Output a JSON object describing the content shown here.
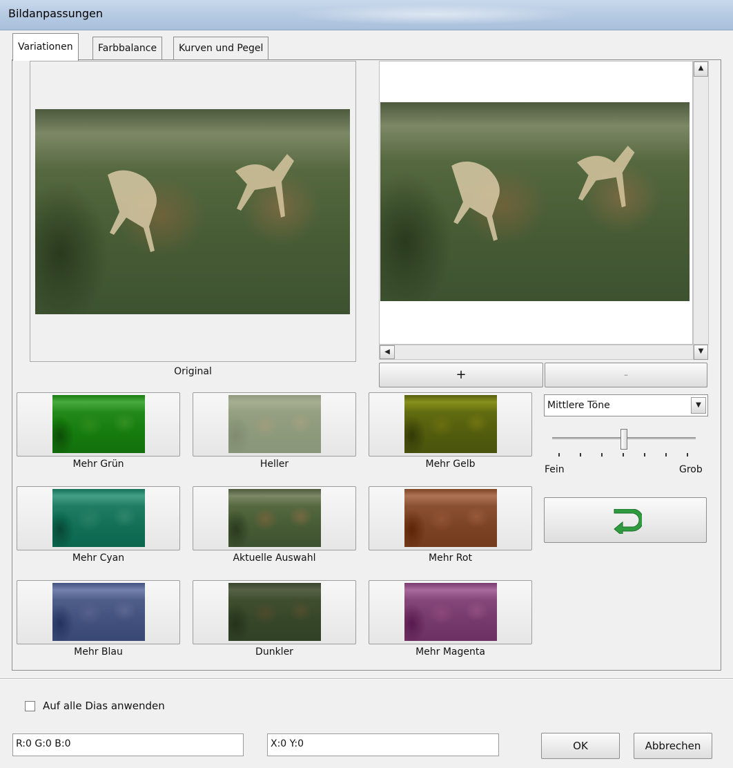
{
  "window": {
    "title": "Bildanpassungen"
  },
  "tabs": [
    {
      "label": "Variationen",
      "active": true
    },
    {
      "label": "Farbbalance",
      "active": false
    },
    {
      "label": "Kurven und Pegel",
      "active": false
    }
  ],
  "original_label": "Original",
  "preview": {
    "zoom_in_label": "+",
    "zoom_out_label": "-"
  },
  "variations": [
    {
      "label": "Mehr Grün",
      "tint": "#3fbf3a"
    },
    {
      "label": "Heller",
      "tint": "#c9cdb6"
    },
    {
      "label": "Mehr Gelb",
      "tint": "#b9c23a"
    },
    {
      "label": "Mehr Cyan",
      "tint": "#3fae98"
    },
    {
      "label": "Aktuelle Auswahl",
      "tint": "#667a4e"
    },
    {
      "label": "Mehr Rot",
      "tint": "#b06a4c"
    },
    {
      "label": "Mehr Blau",
      "tint": "#5c6aa4"
    },
    {
      "label": "Dunkler",
      "tint": "#3f4f30"
    },
    {
      "label": "Mehr Magenta",
      "tint": "#b266a8"
    }
  ],
  "tone_select": {
    "value": "Mittlere Töne"
  },
  "step_slider": {
    "min_label": "Fein",
    "max_label": "Grob",
    "level": 0.5
  },
  "reset": {
    "icon": "undo-arrow-icon",
    "color": "#2e9c3e"
  },
  "apply_all": {
    "label": "Auf alle Dias anwenden",
    "checked": false
  },
  "status": {
    "rgb": "R:0 G:0 B:0",
    "coords": "X:0 Y:0"
  },
  "buttons": {
    "ok": "OK",
    "cancel": "Abbrechen"
  }
}
